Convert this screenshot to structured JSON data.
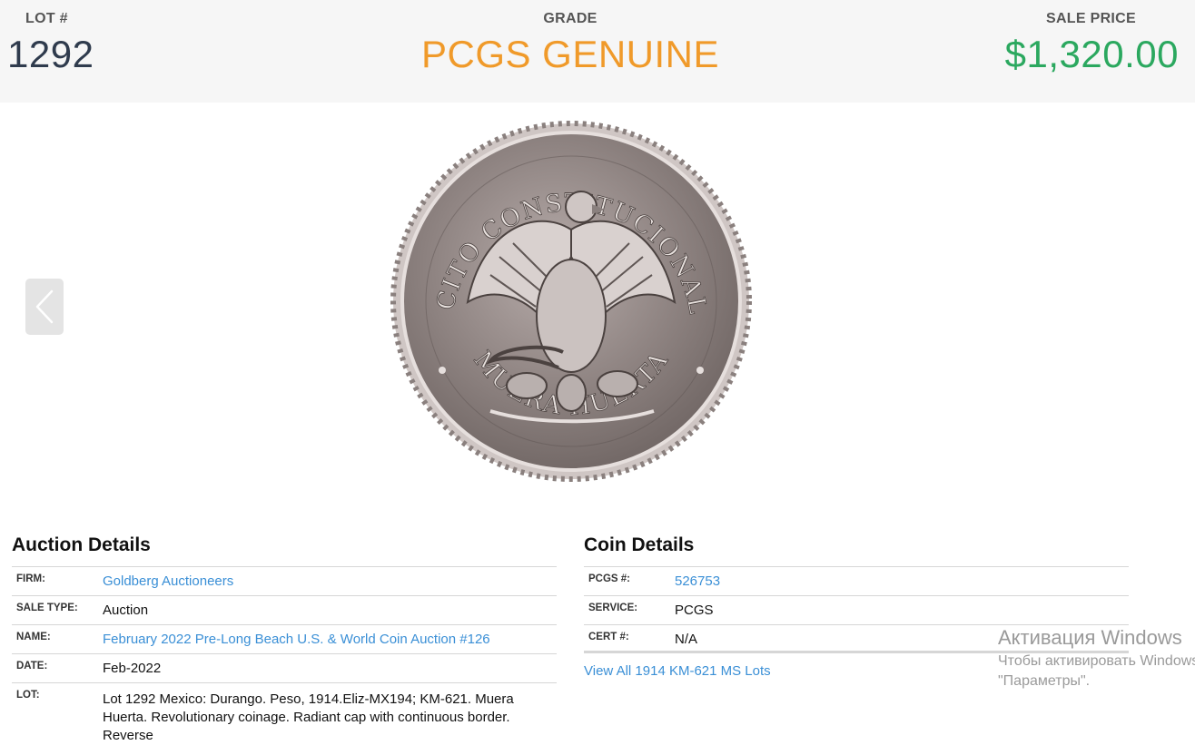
{
  "header": {
    "lot_label": "LOT #",
    "lot_value": "1292",
    "grade_label": "GRADE",
    "grade_value": "PCGS GENUINE",
    "price_label": "SALE PRICE",
    "price_value": "$1,320.00"
  },
  "colors": {
    "lot": "#2f3b4d",
    "grade": "#f09a2a",
    "price": "#2ba85f",
    "link": "#3a8fd6"
  },
  "gallery": {
    "prev_icon": "chevron-left-icon",
    "coin": {
      "top_legend": "EJERCITO CONSTITUCIONALISTA",
      "bottom_legend": "MUERA HUERTA"
    }
  },
  "auction": {
    "title": "Auction Details",
    "rows": [
      {
        "key": "FIRM:",
        "value": "Goldberg Auctioneers"
      },
      {
        "key": "SALE TYPE:",
        "value": "Auction"
      },
      {
        "key": "NAME:",
        "value": "February 2022 Pre-Long Beach U.S. & World Coin Auction #126"
      },
      {
        "key": "DATE:",
        "value": "Feb-2022"
      },
      {
        "key": "LOT:",
        "value": "Lot 1292 Mexico: Durango. Peso, 1914.Eliz-MX194; KM-621. Muera Huerta. Revolutionary coinage. Radiant cap with continuous border. Reverse"
      }
    ]
  },
  "coin_details": {
    "title": "Coin Details",
    "rows": [
      {
        "key": "PCGS #:",
        "value": "526753"
      },
      {
        "key": "SERVICE:",
        "value": "PCGS"
      },
      {
        "key": "CERT #:",
        "value": "N/A"
      }
    ],
    "view_all": "View All 1914 KM-621 MS Lots"
  },
  "watermark": {
    "line1": "Активация Windows",
    "line2": "Чтобы активировать Windows",
    "line3": "\"Параметры\"."
  }
}
